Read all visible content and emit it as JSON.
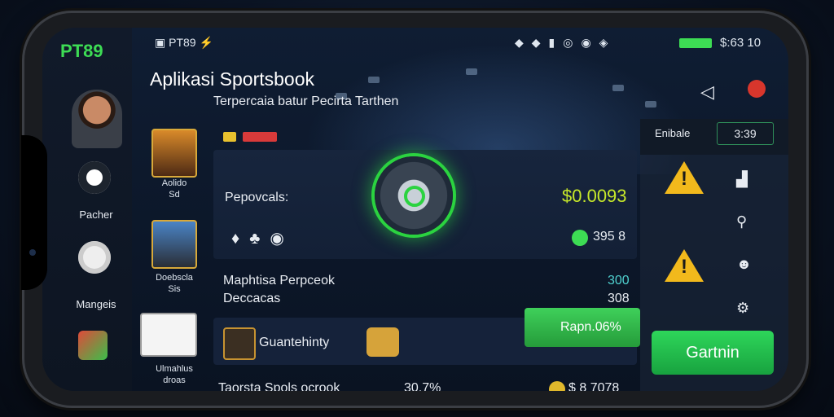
{
  "app": {
    "brand": "PT89",
    "title": "Aplikasi Sportsbook",
    "subtitle": "Terpercaia batur Pecirta Tarthen"
  },
  "statusbar": {
    "left_label": "PT89",
    "time": "$:63 10"
  },
  "left_nav": {
    "items": [
      {
        "label": "Pacher",
        "icon": "compass-icon"
      },
      {
        "label": "Mangeis",
        "icon": "gift-icon"
      }
    ]
  },
  "games": [
    {
      "label_1": "Aolido",
      "label_2": "Sd"
    },
    {
      "label_1": "Doebscla",
      "label_2": "Sis"
    },
    {
      "label_1": "Ulmahlus",
      "label_2": "droas"
    }
  ],
  "main": {
    "bet_label": "Pepovcals:",
    "balance": "$0.0093",
    "counter": "395 8",
    "match_title": "Maphtisa Perpceok",
    "match_sub": "Deccacas",
    "match_val_1": "300",
    "match_val_2": "308",
    "guarantee": "Guantehinty",
    "cta_rate": "Rapn.06%",
    "footer_label": "Taorsta Spols ocrook",
    "footer_val": "30.7%",
    "footer_amount": "$ 8 7078"
  },
  "side": {
    "badge_label": "Enibale",
    "badge_value": "3:39",
    "action_button": "Gartnin"
  },
  "colors": {
    "accent_green": "#3ddc54",
    "warning": "#f2b91c",
    "balance": "#c7e82a"
  }
}
